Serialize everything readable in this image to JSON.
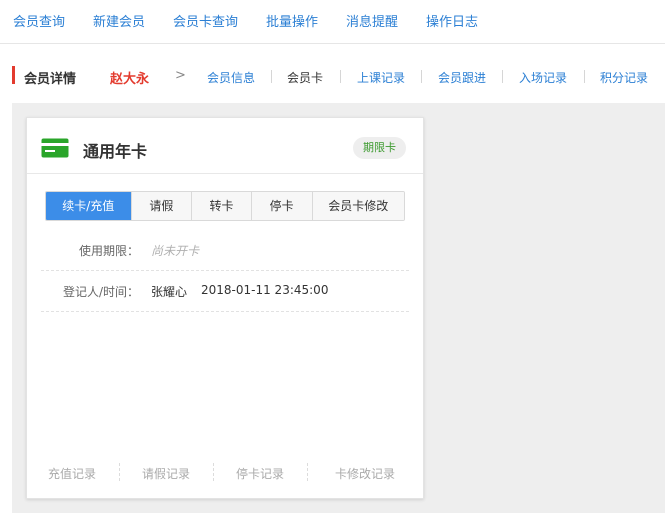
{
  "top_nav": {
    "items": [
      {
        "label": "会员查询"
      },
      {
        "label": "新建会员"
      },
      {
        "label": "会员卡查询"
      },
      {
        "label": "批量操作"
      },
      {
        "label": "消息提醒"
      },
      {
        "label": "操作日志"
      }
    ]
  },
  "subnav": {
    "section_title": "会员详情",
    "member_name": "赵大永",
    "chevron": ">",
    "tabs": [
      {
        "label": "会员信息"
      },
      {
        "label": "会员卡"
      },
      {
        "label": "上课记录"
      },
      {
        "label": "会员跟进"
      },
      {
        "label": "入场记录"
      },
      {
        "label": "积分记录"
      }
    ]
  },
  "card": {
    "title": "通用年卡",
    "badge": "期限卡",
    "icon": "credit-card-icon",
    "actions": [
      {
        "label": "续卡/充值"
      },
      {
        "label": "请假"
      },
      {
        "label": "转卡"
      },
      {
        "label": "停卡"
      },
      {
        "label": "会员卡修改"
      }
    ],
    "rows": {
      "usage_label": "使用期限：",
      "usage_value": "尚未开卡",
      "register_label": "登记人/时间：",
      "register_person": "张耀心",
      "register_time": "2018-01-11 23:45:00"
    },
    "footer_links": [
      {
        "label": "充值记录"
      },
      {
        "label": "请假记录"
      },
      {
        "label": "停卡记录"
      },
      {
        "label": "卡修改记录"
      }
    ]
  },
  "colors": {
    "link": "#2b7fd4",
    "accent_red": "#e33b2e",
    "primary_button": "#3c8de8",
    "badge_text": "#3c9a2f",
    "card_icon": "#2aa52a"
  }
}
